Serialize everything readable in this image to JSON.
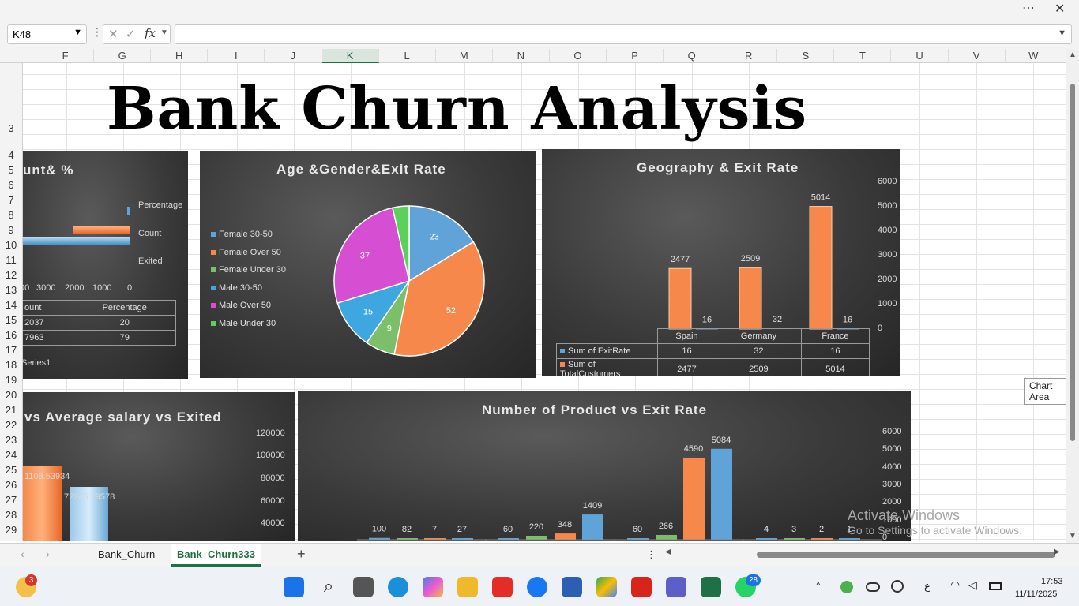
{
  "window": {
    "more_icon": "more-icon",
    "close_icon": "close-icon"
  },
  "formula_bar": {
    "cell_ref": "K48",
    "fx": "fx",
    "formula": ""
  },
  "columns": [
    "F",
    "G",
    "H",
    "I",
    "J",
    "K",
    "L",
    "M",
    "N",
    "O",
    "P",
    "Q",
    "R",
    "S",
    "T",
    "U",
    "V",
    "W"
  ],
  "rows": [
    "3",
    "4",
    "5",
    "6",
    "7",
    "8",
    "9",
    "10",
    "11",
    "12",
    "13",
    "14",
    "15",
    "16",
    "17",
    "18",
    "19",
    "20",
    "21",
    "22",
    "23",
    "24",
    "25",
    "26",
    "27",
    "28",
    "29"
  ],
  "title": "Bank Churn Analysis",
  "charts": {
    "count_pct": {
      "title": "unt& %",
      "categories": [
        "Percentage",
        "Count",
        "Exited"
      ],
      "axis_ticks": [
        "00",
        "3000",
        "2000",
        "1000",
        "0"
      ],
      "table_headers": [
        "ount",
        "Percentage"
      ],
      "table_rows": [
        [
          "2037",
          "20"
        ],
        [
          "7963",
          "79"
        ]
      ],
      "series_label": "Series1"
    },
    "age_gender": {
      "title": "Age &Gender&Exit Rate",
      "legend": [
        "Female 30-50",
        "Female Over 50",
        "Female Under 30",
        "Male 30-50",
        "Male Over 50",
        "Male Under 30"
      ]
    },
    "geography": {
      "title": "Geography & Exit Rate",
      "y_ticks": [
        "6000",
        "5000",
        "4000",
        "3000",
        "2000",
        "1000",
        "0"
      ],
      "countries": [
        "Spain",
        "Germany",
        "France"
      ],
      "row_exit_label": "Sum of ExitRate",
      "row_total_label": "Sum of TotalCustomers"
    },
    "salary": {
      "title": "vs Average salary vs Exited",
      "y_ticks": [
        "120000",
        "100000",
        "80000",
        "60000",
        "40000"
      ],
      "label_a": "1108.53934",
      "label_b": "72245.29578"
    },
    "products": {
      "title": "Number of Product vs Exit Rate",
      "y_ticks": [
        "6000",
        "5000",
        "4000",
        "3000",
        "2000",
        "1000",
        "0"
      ]
    }
  },
  "chart_data": [
    {
      "type": "pie",
      "title": "Age &Gender&Exit Rate",
      "categories": [
        "Female 30-50",
        "Female Over 50",
        "Female Under 30",
        "Male 30-50",
        "Male Over 50",
        "Male Under 30"
      ],
      "values": [
        23,
        52,
        9,
        15,
        37,
        5
      ],
      "colors": [
        "#5fa3d9",
        "#f5884a",
        "#7cbf6a",
        "#3fa7e0",
        "#d64fd2",
        "#5bd05b"
      ]
    },
    {
      "type": "bar",
      "title": "Geography & Exit Rate",
      "categories": [
        "Spain",
        "Germany",
        "France"
      ],
      "series": [
        {
          "name": "Sum of ExitRate",
          "values": [
            16,
            32,
            16
          ]
        },
        {
          "name": "Sum of TotalCustomers",
          "values": [
            2477,
            2509,
            5014
          ]
        }
      ],
      "ylim": [
        0,
        6000
      ]
    },
    {
      "type": "bar",
      "title": "Number of Product vs Exit Rate",
      "groups": [
        {
          "orange": [
            100,
            82,
            7,
            27
          ]
        },
        {
          "orange": [
            60,
            220,
            348,
            1409
          ]
        },
        {
          "orange": [
            60,
            266,
            4590,
            5084
          ]
        },
        {
          "orange": [
            4,
            3,
            2,
            1
          ]
        }
      ],
      "bars": [
        {
          "v": 100,
          "c": "#5fa3d9"
        },
        {
          "v": 82,
          "c": "#7cbf6a"
        },
        {
          "v": 7,
          "c": "#f5884a"
        },
        {
          "v": 27,
          "c": "#5fa3d9"
        },
        {
          "v": 60,
          "c": "#5fa3d9"
        },
        {
          "v": 220,
          "c": "#7cbf6a"
        },
        {
          "v": 348,
          "c": "#f5884a"
        },
        {
          "v": 1409,
          "c": "#5fa3d9"
        },
        {
          "v": 60,
          "c": "#5fa3d9"
        },
        {
          "v": 266,
          "c": "#7cbf6a"
        },
        {
          "v": 4590,
          "c": "#f5884a"
        },
        {
          "v": 5084,
          "c": "#5fa3d9"
        },
        {
          "v": 4,
          "c": "#5fa3d9"
        },
        {
          "v": 3,
          "c": "#7cbf6a"
        },
        {
          "v": 2,
          "c": "#f5884a"
        },
        {
          "v": 1,
          "c": "#5fa3d9"
        }
      ],
      "ylim": [
        0,
        6000
      ]
    },
    {
      "type": "bar",
      "title": "unt& %",
      "categories": [
        "Count"
      ],
      "values": [
        2037,
        7963
      ]
    }
  ],
  "sheet_tabs": [
    "Bank_Churn",
    "Bank_Churn333"
  ],
  "active_tab": "Bank_Churn333",
  "tooltip": "Chart Area",
  "watermark": {
    "line1": "Activate Windows",
    "line2": "Go to Settings to activate Windows."
  },
  "taskbar": {
    "weather_badge": "3",
    "whatsapp_badge": "28",
    "time": "17:53",
    "date": "11/11/2025",
    "lang": "ع"
  }
}
